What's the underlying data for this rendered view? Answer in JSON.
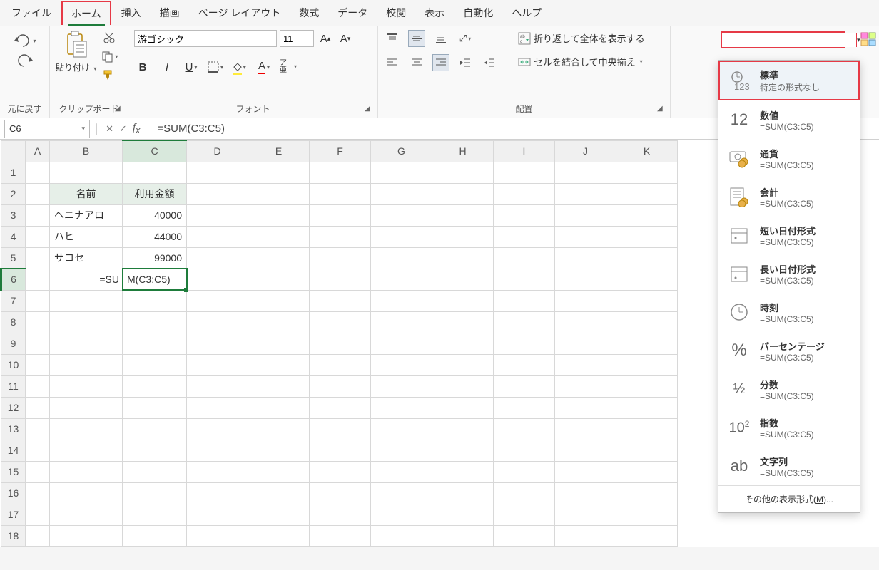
{
  "menu": {
    "items": [
      "ファイル",
      "ホーム",
      "挿入",
      "描画",
      "ページ レイアウト",
      "数式",
      "データ",
      "校閲",
      "表示",
      "自動化",
      "ヘルプ"
    ],
    "active_index": 1
  },
  "ribbon": {
    "undo_label": "元に戻す",
    "clipboard_label": "クリップボード",
    "paste_label": "貼り付け",
    "font_label": "フォント",
    "font_name": "游ゴシック",
    "font_size": "11",
    "align_label": "配置",
    "wrap_label": "折り返して全体を表示する",
    "merge_label": "セルを結合して中央揃え",
    "ruby_label": "ア亜"
  },
  "numfmt_combo": {
    "value": ""
  },
  "formula_bar": {
    "name_box": "C6",
    "formula": "=SUM(C3:C5)"
  },
  "grid": {
    "columns": [
      "A",
      "B",
      "C",
      "D",
      "E",
      "F",
      "G",
      "H",
      "I",
      "J",
      "K"
    ],
    "rows": [
      1,
      2,
      3,
      4,
      5,
      6,
      7,
      8,
      9,
      10,
      11,
      12,
      13,
      14,
      15,
      16,
      17,
      18
    ],
    "headers": {
      "b2": "名前",
      "c2": "利用金額"
    },
    "data": [
      {
        "b": "ヘニナアロ",
        "c": "40000"
      },
      {
        "b": "ハヒ",
        "c": "44000"
      },
      {
        "b": "サコセ",
        "c": "99000"
      }
    ],
    "editing": {
      "row": 6,
      "full": "=SUM(C3:C5)",
      "left": "=SU",
      "right": "M(C3:C5)"
    }
  },
  "numfmt_dropdown": {
    "items": [
      {
        "icon": "general",
        "title": "標準",
        "sub": "特定の形式なし"
      },
      {
        "icon": "number",
        "title": "数値",
        "sub": "=SUM(C3:C5)"
      },
      {
        "icon": "currency",
        "title": "通貨",
        "sub": "=SUM(C3:C5)"
      },
      {
        "icon": "account",
        "title": "会計",
        "sub": "=SUM(C3:C5)"
      },
      {
        "icon": "sdate",
        "title": "短い日付形式",
        "sub": "=SUM(C3:C5)"
      },
      {
        "icon": "ldate",
        "title": "長い日付形式",
        "sub": "=SUM(C3:C5)"
      },
      {
        "icon": "time",
        "title": "時刻",
        "sub": "=SUM(C3:C5)"
      },
      {
        "icon": "percent",
        "title": "パーセンテージ",
        "sub": "=SUM(C3:C5)"
      },
      {
        "icon": "fraction",
        "title": "分数",
        "sub": "=SUM(C3:C5)"
      },
      {
        "icon": "sci",
        "title": "指数",
        "sub": "=SUM(C3:C5)"
      },
      {
        "icon": "text",
        "title": "文字列",
        "sub": "=SUM(C3:C5)"
      }
    ],
    "footer_pre": "その他の表示形式(",
    "footer_key": "M",
    "footer_post": ")..."
  }
}
